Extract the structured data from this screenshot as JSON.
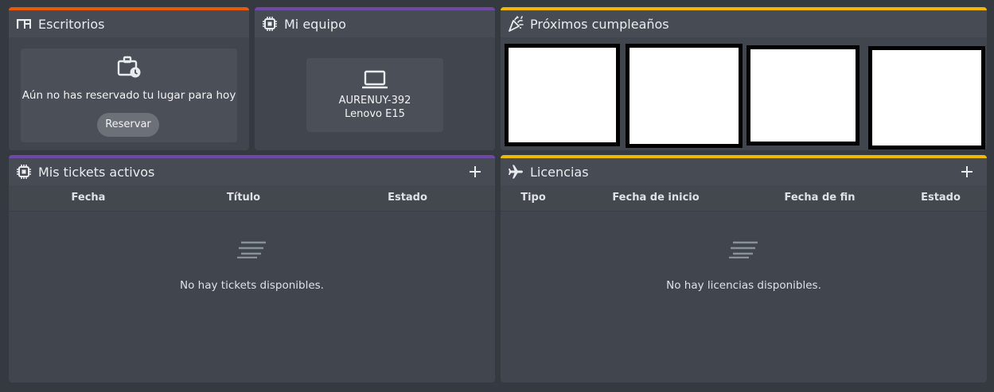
{
  "colors": {
    "background": "#353a40",
    "card": "#41464e",
    "accent_orange": "#e8590c",
    "accent_purple": "#7048a8",
    "accent_yellow": "#f2b705"
  },
  "escritorios": {
    "title": "Escritorios",
    "icon": "desk-icon",
    "message": "Aún no has reservado tu lugar para hoy",
    "reserve_label": "Reservar",
    "message_icon": "briefcase-clock-icon"
  },
  "equipo": {
    "title": "Mi equipo",
    "icon": "chip-icon",
    "device_icon": "laptop-icon",
    "device_name": "AURENUY-392",
    "device_model": "Lenovo E15"
  },
  "cumpleanos": {
    "title": "Próximos cumpleaños",
    "icon": "party-popper-icon"
  },
  "tickets": {
    "title": "Mis tickets activos",
    "icon": "chip-icon",
    "add_icon": "plus-icon",
    "columns": [
      "Fecha",
      "Título",
      "Estado"
    ],
    "empty_icon": "empty-lines-icon",
    "empty_text": "No hay tickets disponibles."
  },
  "licencias": {
    "title": "Licencias",
    "icon": "airplane-icon",
    "add_icon": "plus-icon",
    "columns": [
      "Tipo",
      "Fecha de inicio",
      "Fecha de fin",
      "Estado"
    ],
    "empty_icon": "empty-lines-icon",
    "empty_text": "No hay licencias disponibles."
  }
}
